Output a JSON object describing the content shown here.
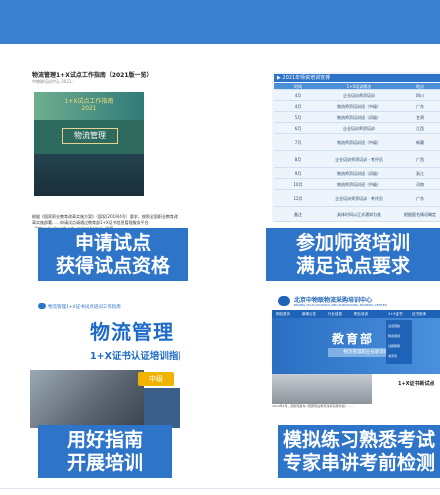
{
  "cards": [
    {
      "line1": "申请试点",
      "line2": "获得试点资格",
      "doc_title": "物流管理1+X试点工作指南（2021版一览）",
      "doc_sub": "中物联培训中心 2021-",
      "cover_title": "1+X试点工作指南",
      "cover_year": "2021",
      "cover_name": "物流管理",
      "para": "根据《国家职业教育改革实施方案》（国发[2019]4号）要求，按照全国职业教育改革实施部署……申请试点请通过教育部1+X证书信息管理服务平台（https://vslc.ncb.edu.cn/csr-home）申报……"
    },
    {
      "line1": "参加师资培训",
      "line2": "满足试点要求",
      "table_title": "▶ 2021年师资培训安排",
      "table_head": [
        "时间",
        "1+X培训期次",
        "地点"
      ],
      "rows": [
        [
          "4月",
          "企业培训师资培训",
          "四川"
        ],
        [
          "4月",
          "物流师资培训班（中级）",
          "广东"
        ],
        [
          "5月",
          "物流师资培训班（初级）",
          "甘肃"
        ],
        [
          "6月",
          "企业培训师资培训",
          "江西"
        ],
        [
          "7月",
          "物流师资培训班（中级）",
          "新疆"
        ],
        [
          "8月",
          "企业培训师资培训 · 考评员",
          "广西"
        ],
        [
          "9月",
          "物流师资培训班（初级）",
          "浙江"
        ],
        [
          "10月",
          "物流师资培训班（中级）",
          "河南"
        ],
        [
          "12月",
          "企业培训师资培训 · 考评员",
          "广东"
        ],
        [
          "备注",
          "具体时间以正式通知为准",
          "根据报名情况确定"
        ]
      ]
    },
    {
      "line1": "用好指南",
      "line2": "开展培训",
      "header": "物流管理1+X证书试点培训工作指南",
      "big": "物流管理",
      "sub": "1+X证书认证培训指南",
      "badge": "中级"
    },
    {
      "line1": "模拟练习熟悉考试",
      "line2": "专家串讲考前检测",
      "site_name": "北京中物联物流采购培训中心",
      "site_name_en": "BEIJING CFLP LOGISTICS AND PURCHASING TRAINING CENTER",
      "nav": [
        "网站首页",
        "新闻公告",
        "行业信息",
        "职业培训",
        "1+X证书",
        "证书查询"
      ],
      "hero": "教育部",
      "hero_sub": "物流管理职业技能等级",
      "dropdown": [
        "试点院校",
        "师资培训",
        "试题题库",
        "考评员"
      ],
      "news_title": "1+X证书新试点",
      "news_text": "2019年4月，国务院发布《国家职业教育改革实施方案》……"
    }
  ],
  "colors": {
    "accent": "#2e74c9",
    "topbar": "#3a7fd0"
  }
}
